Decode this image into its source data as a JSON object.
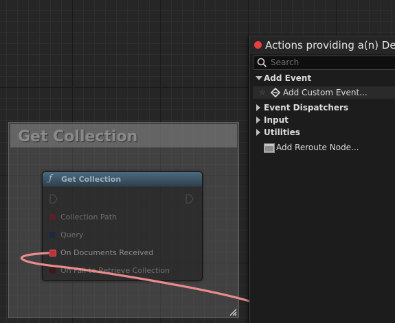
{
  "graph": {
    "comment": {
      "title": "Get Collection"
    },
    "node": {
      "title": "Get Collection",
      "function_icon": "ƒ",
      "header_color": "#4b6a80",
      "pins": [
        {
          "label": "Collection Path",
          "color": "#5a1f2a"
        },
        {
          "label": "Query",
          "color": "#1c2a40"
        },
        {
          "label": "On Documents Received",
          "color": "#c0303a"
        },
        {
          "label": "On Fail to Retrieve Collection",
          "color": "#3a1a1a"
        }
      ]
    },
    "wire_color": "#e98c8c"
  },
  "menu": {
    "title": "Actions providing a(n) Dele",
    "search": {
      "placeholder": "Search",
      "value": ""
    },
    "sections": [
      {
        "label": "Add Event",
        "expanded": true,
        "icon": "chevron-down-icon"
      },
      {
        "label": "Event Dispatchers",
        "expanded": false,
        "icon": "chevron-right-icon"
      },
      {
        "label": "Input",
        "expanded": false,
        "icon": "chevron-right-icon"
      },
      {
        "label": "Utilities",
        "expanded": false,
        "icon": "chevron-right-icon"
      }
    ],
    "items": {
      "add_custom_event": "Add Custom Event...",
      "add_reroute_node": "Add Reroute Node..."
    },
    "accent_color": "#e64141"
  }
}
